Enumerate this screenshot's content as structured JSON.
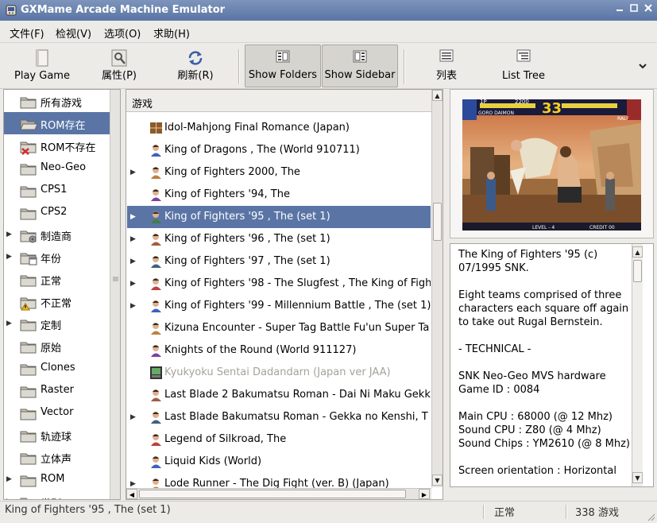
{
  "window": {
    "title": "GXMame Arcade Machine Emulator",
    "controls": [
      "minimize",
      "maximize",
      "close"
    ]
  },
  "menubar": {
    "items": [
      {
        "label": "文件(F)"
      },
      {
        "label": "检视(V)"
      },
      {
        "label": "选项(O)"
      },
      {
        "label": "求助(H)"
      }
    ]
  },
  "toolbar": {
    "play_game": "Play Game",
    "properties": "属性(P)",
    "refresh": "刷新(R)",
    "show_folders": "Show Folders",
    "show_sidebar": "Show Sidebar",
    "list": "列表",
    "list_tree": "List Tree"
  },
  "folders": {
    "items": [
      {
        "label": "所有游戏",
        "icon": "folder-icon",
        "expander": false,
        "selected": false
      },
      {
        "label": "ROM存在",
        "icon": "folder-open-icon",
        "expander": false,
        "selected": true
      },
      {
        "label": "ROM不存在",
        "icon": "folder-missing-icon",
        "expander": false,
        "selected": false
      },
      {
        "label": "Neo-Geo",
        "icon": "folder-icon",
        "expander": false,
        "selected": false
      },
      {
        "label": "CPS1",
        "icon": "folder-icon",
        "expander": false,
        "selected": false
      },
      {
        "label": "CPS2",
        "icon": "folder-icon",
        "expander": false,
        "selected": false
      },
      {
        "label": "制造商",
        "icon": "folder-manufacturer-icon",
        "expander": true,
        "selected": false
      },
      {
        "label": "年份",
        "icon": "folder-year-icon",
        "expander": true,
        "selected": false
      },
      {
        "label": "正常",
        "icon": "folder-icon",
        "expander": false,
        "selected": false
      },
      {
        "label": "不正常",
        "icon": "folder-warning-icon",
        "expander": false,
        "selected": false
      },
      {
        "label": "定制",
        "icon": "folder-icon",
        "expander": true,
        "selected": false
      },
      {
        "label": "原始",
        "icon": "folder-icon",
        "expander": false,
        "selected": false
      },
      {
        "label": "Clones",
        "icon": "folder-icon",
        "expander": false,
        "selected": false
      },
      {
        "label": "Raster",
        "icon": "folder-icon",
        "expander": false,
        "selected": false
      },
      {
        "label": "Vector",
        "icon": "folder-icon",
        "expander": false,
        "selected": false
      },
      {
        "label": "轨迹球",
        "icon": "folder-icon",
        "expander": false,
        "selected": false
      },
      {
        "label": "立体声",
        "icon": "folder-icon",
        "expander": false,
        "selected": false
      },
      {
        "label": "ROM",
        "icon": "folder-icon",
        "expander": true,
        "selected": false
      },
      {
        "label": "类别",
        "icon": "folder-icon",
        "expander": true,
        "selected": false
      }
    ]
  },
  "gamelist": {
    "column_header": "游戏",
    "rows": [
      {
        "label": "Idol-Mahjong Final Romance  (Japan)",
        "expander": false,
        "selected": false,
        "dim": false,
        "icon": "mahjong-icon"
      },
      {
        "label": "King of Dragons , The (World 910711)",
        "expander": false,
        "selected": false,
        "dim": false,
        "icon": "game-icon"
      },
      {
        "label": "King of Fighters 2000, The",
        "expander": true,
        "selected": false,
        "dim": false,
        "icon": "game-icon"
      },
      {
        "label": "King of Fighters '94, The",
        "expander": false,
        "selected": false,
        "dim": false,
        "icon": "game-icon"
      },
      {
        "label": "King of Fighters '95 , The (set 1)",
        "expander": true,
        "selected": true,
        "dim": false,
        "icon": "game-icon"
      },
      {
        "label": "King of Fighters '96 , The (set 1)",
        "expander": true,
        "selected": false,
        "dim": false,
        "icon": "game-icon"
      },
      {
        "label": "King of Fighters '97 , The (set 1)",
        "expander": true,
        "selected": false,
        "dim": false,
        "icon": "game-icon"
      },
      {
        "label": "King of Fighters '98 - The Slugfest , The  King of Fight",
        "expander": true,
        "selected": false,
        "dim": false,
        "icon": "game-icon"
      },
      {
        "label": "King of Fighters '99 - Millennium Battle , The (set 1)",
        "expander": true,
        "selected": false,
        "dim": false,
        "icon": "game-icon"
      },
      {
        "label": "Kizuna Encounter - Super Tag Battle   Fu'un Super Ta",
        "expander": false,
        "selected": false,
        "dim": false,
        "icon": "game-icon"
      },
      {
        "label": "Knights of the Round  (World 911127)",
        "expander": false,
        "selected": false,
        "dim": false,
        "icon": "game-icon"
      },
      {
        "label": "Kyukyoku Sentai Dadandarn  (Japan ver JAA)",
        "expander": false,
        "selected": false,
        "dim": true,
        "icon": "missing-rom-icon"
      },
      {
        "label": "Last Blade 2   Bakumatsu Roman - Dai Ni Maku Gekk",
        "expander": false,
        "selected": false,
        "dim": false,
        "icon": "game-icon"
      },
      {
        "label": "Last Blade   Bakumatsu Roman - Gekka no Kenshi, T",
        "expander": true,
        "selected": false,
        "dim": false,
        "icon": "game-icon"
      },
      {
        "label": "Legend of Silkroad, The",
        "expander": false,
        "selected": false,
        "dim": false,
        "icon": "game-icon"
      },
      {
        "label": "Liquid Kids  (World)",
        "expander": false,
        "selected": false,
        "dim": false,
        "icon": "game-icon"
      },
      {
        "label": "Lode Runner - The Dig Fight  (ver. B) (Japan)",
        "expander": true,
        "selected": false,
        "dim": false,
        "icon": "game-icon"
      }
    ]
  },
  "sidebar": {
    "screenshot_hud": {
      "p1_label": "1P",
      "score": "2200",
      "timer": "33",
      "p1_name": "GORO DAIMON",
      "p2_tag": "RALF",
      "level": "LEVEL - 4",
      "credit": "CREDIT 00"
    },
    "description": "The King of Fighters '95 (c)\n07/1995 SNK.\n\nEight teams comprised of three characters each square off again to take out Rugal Bernstein.\n\n- TECHNICAL -\n\nSNK Neo-Geo MVS hardware\nGame ID : 0084\n\nMain CPU : 68000 (@ 12 Mhz)\nSound CPU : Z80 (@ 4 Mhz)\nSound Chips : YM2610 (@ 8 Mhz)\n\nScreen orientation : Horizontal"
  },
  "statusbar": {
    "selected_game": "King of Fighters '95 , The (set 1)",
    "status": "正常",
    "count": "338 游戏"
  },
  "colors": {
    "selection": "#5a75a5",
    "titlebar_top": "#7d94bb",
    "titlebar_bottom": "#5a75a5",
    "window_bg": "#ecebe8",
    "folder_icon": "#c8c5bd"
  }
}
